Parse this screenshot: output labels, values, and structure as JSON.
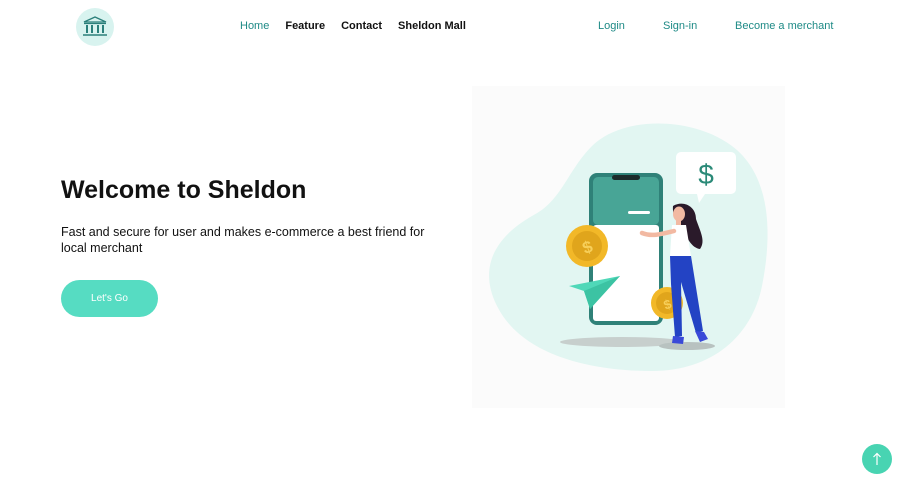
{
  "nav": {
    "links": [
      {
        "label": "Home"
      },
      {
        "label": "Feature"
      },
      {
        "label": "Contact"
      },
      {
        "label": "Sheldon Mall"
      }
    ],
    "login": "Login",
    "signin": "Sign-in",
    "merchant": "Become a merchant"
  },
  "hero": {
    "title": "Welcome to Sheldon",
    "subtitle": "Fast and secure for user and makes e-commerce a best friend for local merchant",
    "cta": "Let's Go",
    "speech_symbol": "$",
    "coin_symbol": "$"
  },
  "colors": {
    "accent": "#1e8a86",
    "button": "#56dcc2",
    "logo_bg": "#d8f3ef",
    "blob": "#e2f6f2",
    "coin": "#f2b828",
    "phone": "#3b9e92",
    "woman_pants": "#2343c4"
  },
  "icons": {
    "logo": "bank-icon",
    "scroll_top": "arrow-up-icon"
  }
}
